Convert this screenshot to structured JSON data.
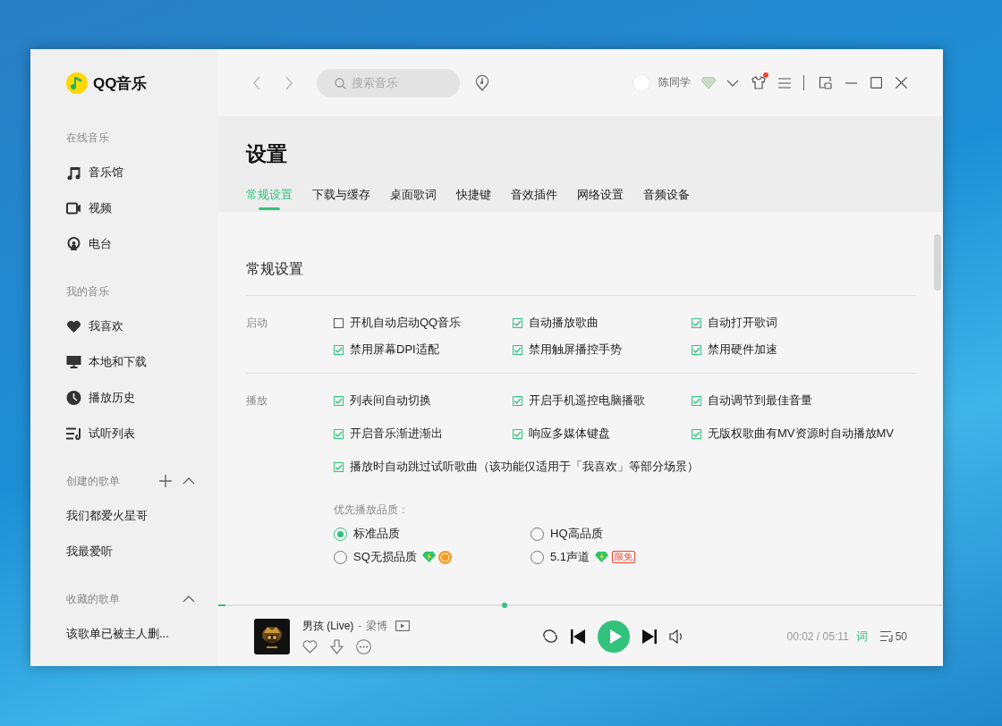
{
  "app": {
    "name": "QQ音乐"
  },
  "sidebar": {
    "sections": [
      {
        "title": "在线音乐",
        "items": [
          {
            "label": "音乐馆"
          },
          {
            "label": "视频"
          },
          {
            "label": "电台"
          }
        ]
      },
      {
        "title": "我的音乐",
        "items": [
          {
            "label": "我喜欢"
          },
          {
            "label": "本地和下载"
          },
          {
            "label": "播放历史"
          },
          {
            "label": "试听列表"
          }
        ]
      },
      {
        "title": "创建的歌单",
        "add": true,
        "expanded": true,
        "items": [
          {
            "label": "我们都爱火星哥"
          },
          {
            "label": "我最爱听"
          }
        ]
      },
      {
        "title": "收藏的歌单",
        "add": false,
        "expanded": true,
        "items": [
          {
            "label": "该歌单已被主人删..."
          }
        ]
      }
    ]
  },
  "header": {
    "search": {
      "placeholder": "搜索音乐"
    },
    "user": {
      "name": "陈同学"
    },
    "notification": true
  },
  "settings": {
    "title": "设置",
    "tabs": [
      {
        "label": "常规设置",
        "selected": true
      },
      {
        "label": "下载与缓存",
        "selected": false
      },
      {
        "label": "桌面歌词",
        "selected": false
      },
      {
        "label": "快捷键",
        "selected": false
      },
      {
        "label": "音效插件",
        "selected": false
      },
      {
        "label": "网络设置",
        "selected": false
      },
      {
        "label": "音频设备",
        "selected": false
      }
    ],
    "section_title": "常规设置",
    "groups": [
      {
        "label": "启动",
        "options": [
          {
            "label": "开机自动启动QQ音乐",
            "checked": false
          },
          {
            "label": "自动播放歌曲",
            "checked": true
          },
          {
            "label": "自动打开歌词",
            "checked": true
          },
          {
            "label": "禁用屏幕DPI适配",
            "checked": true
          },
          {
            "label": "禁用触屏播控手势",
            "checked": true
          },
          {
            "label": "禁用硬件加速",
            "checked": true
          }
        ]
      },
      {
        "label": "播放",
        "options": [
          {
            "label": "列表间自动切换",
            "checked": true
          },
          {
            "label": "开启手机遥控电脑播歌",
            "checked": true
          },
          {
            "label": "自动调节到最佳音量",
            "checked": true
          },
          {
            "label": "开启音乐渐进渐出",
            "checked": true
          },
          {
            "label": "响应多媒体键盘",
            "checked": true
          },
          {
            "label": "无版权歌曲有MV资源时自动播放MV",
            "checked": true
          },
          {
            "label": "播放时自动跳过试听歌曲（该功能仅适用于「我喜欢」等部分场景）",
            "checked": true
          }
        ],
        "quality": {
          "label": "优先播放品质：",
          "options": [
            {
              "label": "标准品质",
              "selected": true
            },
            {
              "label": "HQ高品质",
              "selected": false
            },
            {
              "label": "SQ无损品质",
              "selected": false,
              "badges": [
                {
                  "kind": "diamond"
                },
                {
                  "kind": "coin"
                }
              ]
            },
            {
              "label": "5.1声道",
              "selected": false,
              "badges": [
                {
                  "kind": "diamond"
                },
                {
                  "kind": "tag",
                  "text": "限免"
                }
              ]
            }
          ]
        }
      }
    ]
  },
  "player": {
    "progress": {
      "level": 0.01
    },
    "buffer": {
      "level": 0.395
    },
    "song": {
      "title": "男孩 (Live)",
      "separator": "-",
      "artist": "梁博"
    },
    "time": "00:02 / 05:11",
    "lyrics": "词",
    "playlist_count": "50"
  }
}
